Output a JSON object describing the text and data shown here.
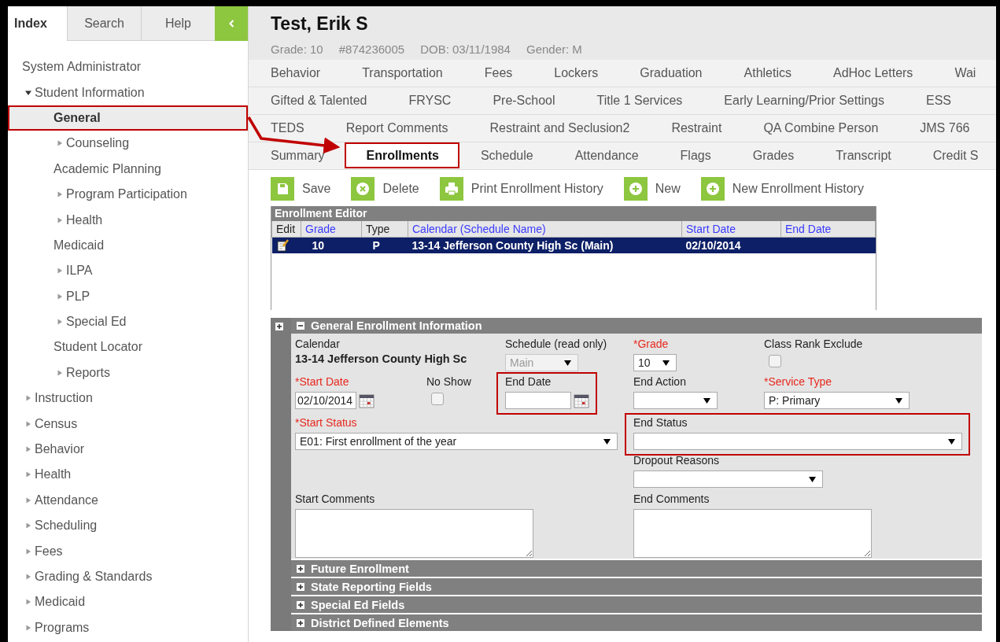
{
  "sidebar": {
    "tabs": [
      {
        "label": "Index",
        "selected": true
      },
      {
        "label": "Search",
        "selected": false
      },
      {
        "label": "Help",
        "selected": false
      }
    ],
    "tree": [
      {
        "label": "System Administrator",
        "kind": "page",
        "selected": false,
        "highlighted": false
      },
      {
        "label": "Student Information",
        "kind": "folder",
        "expanded": true,
        "selected": false,
        "highlighted": false,
        "children": [
          {
            "label": "General",
            "kind": "page",
            "selected": true,
            "highlighted": true
          },
          {
            "label": "Counseling",
            "kind": "folder",
            "expanded": false,
            "selected": false,
            "highlighted": false
          },
          {
            "label": "Academic Planning",
            "kind": "page",
            "selected": false,
            "highlighted": false
          },
          {
            "label": "Program Participation",
            "kind": "folder",
            "expanded": false,
            "selected": false,
            "highlighted": false
          },
          {
            "label": "Health",
            "kind": "folder",
            "expanded": false,
            "selected": false,
            "highlighted": false
          },
          {
            "label": "Medicaid",
            "kind": "page",
            "selected": false,
            "highlighted": false
          },
          {
            "label": "ILPA",
            "kind": "folder",
            "expanded": false,
            "selected": false,
            "highlighted": false
          },
          {
            "label": "PLP",
            "kind": "folder",
            "expanded": false,
            "selected": false,
            "highlighted": false
          },
          {
            "label": "Special Ed",
            "kind": "folder",
            "expanded": false,
            "selected": false,
            "highlighted": false
          },
          {
            "label": "Student Locator",
            "kind": "page",
            "selected": false,
            "highlighted": false
          },
          {
            "label": "Reports",
            "kind": "folder",
            "expanded": false,
            "selected": false,
            "highlighted": false
          }
        ]
      },
      {
        "label": "Instruction",
        "kind": "folder",
        "expanded": false,
        "selected": false,
        "highlighted": false
      },
      {
        "label": "Census",
        "kind": "folder",
        "expanded": false,
        "selected": false,
        "highlighted": false
      },
      {
        "label": "Behavior",
        "kind": "folder",
        "expanded": false,
        "selected": false,
        "highlighted": false
      },
      {
        "label": "Health",
        "kind": "folder",
        "expanded": false,
        "selected": false,
        "highlighted": false
      },
      {
        "label": "Attendance",
        "kind": "folder",
        "expanded": false,
        "selected": false,
        "highlighted": false
      },
      {
        "label": "Scheduling",
        "kind": "folder",
        "expanded": false,
        "selected": false,
        "highlighted": false
      },
      {
        "label": "Fees",
        "kind": "folder",
        "expanded": false,
        "selected": false,
        "highlighted": false
      },
      {
        "label": "Grading & Standards",
        "kind": "folder",
        "expanded": false,
        "selected": false,
        "highlighted": false
      },
      {
        "label": "Medicaid",
        "kind": "folder",
        "expanded": false,
        "selected": false,
        "highlighted": false
      },
      {
        "label": "Programs",
        "kind": "folder",
        "expanded": false,
        "selected": false,
        "highlighted": false
      }
    ]
  },
  "student": {
    "name": "Test, Erik S",
    "details": [
      "Grade: 10",
      "#874236005",
      "DOB: 03/11/1984",
      "Gender: M"
    ]
  },
  "tab_rows": [
    [
      {
        "label": "Behavior",
        "selected": false,
        "highlighted": false
      },
      {
        "label": "Transportation",
        "selected": false,
        "highlighted": false
      },
      {
        "label": "Fees",
        "selected": false,
        "highlighted": false
      },
      {
        "label": "Lockers",
        "selected": false,
        "highlighted": false
      },
      {
        "label": "Graduation",
        "selected": false,
        "highlighted": false
      },
      {
        "label": "Athletics",
        "selected": false,
        "highlighted": false
      },
      {
        "label": "AdHoc Letters",
        "selected": false,
        "highlighted": false
      },
      {
        "label": "Wai",
        "selected": false,
        "highlighted": false
      }
    ],
    [
      {
        "label": "Gifted & Talented",
        "selected": false,
        "highlighted": false
      },
      {
        "label": "FRYSC",
        "selected": false,
        "highlighted": false
      },
      {
        "label": "Pre-School",
        "selected": false,
        "highlighted": false
      },
      {
        "label": "Title 1 Services",
        "selected": false,
        "highlighted": false
      },
      {
        "label": "Early Learning/Prior Settings",
        "selected": false,
        "highlighted": false
      },
      {
        "label": "ESS",
        "selected": false,
        "highlighted": false
      }
    ],
    [
      {
        "label": "TEDS",
        "selected": false,
        "highlighted": false
      },
      {
        "label": "Report Comments",
        "selected": false,
        "highlighted": false
      },
      {
        "label": "Restraint and Seclusion2",
        "selected": false,
        "highlighted": false
      },
      {
        "label": "Restraint",
        "selected": false,
        "highlighted": false
      },
      {
        "label": "QA Combine Person",
        "selected": false,
        "highlighted": false
      },
      {
        "label": "JMS 766",
        "selected": false,
        "highlighted": false
      }
    ],
    [
      {
        "label": "Summary",
        "selected": false,
        "highlighted": false
      },
      {
        "label": "Enrollments",
        "selected": true,
        "highlighted": true
      },
      {
        "label": "Schedule",
        "selected": false,
        "highlighted": false
      },
      {
        "label": "Attendance",
        "selected": false,
        "highlighted": false
      },
      {
        "label": "Flags",
        "selected": false,
        "highlighted": false
      },
      {
        "label": "Grades",
        "selected": false,
        "highlighted": false
      },
      {
        "label": "Transcript",
        "selected": false,
        "highlighted": false
      },
      {
        "label": "Credit S",
        "selected": false,
        "highlighted": false
      }
    ]
  ],
  "toolbar": [
    {
      "label": "Save",
      "kind": "save"
    },
    {
      "label": "Delete",
      "kind": "delete"
    },
    {
      "label": "Print Enrollment History",
      "kind": "print"
    },
    {
      "label": "New",
      "kind": "new"
    },
    {
      "label": "New Enrollment History",
      "kind": "new"
    }
  ],
  "editor": {
    "title": "Enrollment Editor",
    "columns": [
      {
        "label": "Edit",
        "sortable": false
      },
      {
        "label": "Grade",
        "sortable": true
      },
      {
        "label": "Type",
        "sortable": false
      },
      {
        "label": "Calendar (Schedule Name)",
        "sortable": true
      },
      {
        "label": "Start Date",
        "sortable": true
      },
      {
        "label": "End Date",
        "sortable": true
      }
    ],
    "rows": [
      {
        "selected": true,
        "grade": "10",
        "type": "P",
        "calendar": "13-14 Jefferson County High Sc (Main)",
        "start_date": "02/10/2014"
      }
    ]
  },
  "panel": {
    "title": "General Enrollment Information",
    "expanded": true,
    "fields": [
      {
        "label": "Calendar",
        "kind": "static",
        "required": false,
        "highlighted": false,
        "value": "13-14 Jefferson County High Sc"
      },
      {
        "label": "Schedule (read only)",
        "kind": "select",
        "required": false,
        "highlighted": false,
        "disabled": true,
        "value": "Main"
      },
      {
        "label": "*Grade",
        "kind": "select",
        "required": true,
        "highlighted": false,
        "value": "10"
      },
      {
        "label": "Class Rank Exclude",
        "kind": "checkbox",
        "required": false,
        "highlighted": false,
        "checked": false
      },
      {
        "label": "*Start Date",
        "kind": "date",
        "required": true,
        "highlighted": false,
        "value": "02/10/2014"
      },
      {
        "label": "No Show",
        "kind": "checkbox",
        "required": false,
        "highlighted": false,
        "checked": false
      },
      {
        "label": "End Date",
        "kind": "date",
        "required": false,
        "highlighted": true
      },
      {
        "label": "End Action",
        "kind": "select",
        "required": false,
        "highlighted": false
      },
      {
        "label": "*Service Type",
        "kind": "select",
        "required": true,
        "highlighted": false,
        "value": "P: Primary"
      },
      {
        "label": "*Start Status",
        "kind": "select",
        "required": true,
        "highlighted": false,
        "value": "E01: First enrollment of the year"
      },
      {
        "label": "End Status",
        "kind": "select",
        "required": false,
        "highlighted": true
      },
      {
        "label": "Dropout Reasons",
        "kind": "select",
        "required": false,
        "highlighted": false
      },
      {
        "label": "Start Comments",
        "kind": "textarea",
        "required": false,
        "highlighted": false
      },
      {
        "label": "End Comments",
        "kind": "textarea",
        "required": false,
        "highlighted": false
      }
    ]
  },
  "collapsed_sections": [
    {
      "title": "Future Enrollment",
      "expanded": false
    },
    {
      "title": "State Reporting Fields",
      "expanded": false
    },
    {
      "title": "Special Ed Fields",
      "expanded": false
    },
    {
      "title": "District Defined Elements",
      "expanded": false
    }
  ],
  "callout_arrow": true
}
